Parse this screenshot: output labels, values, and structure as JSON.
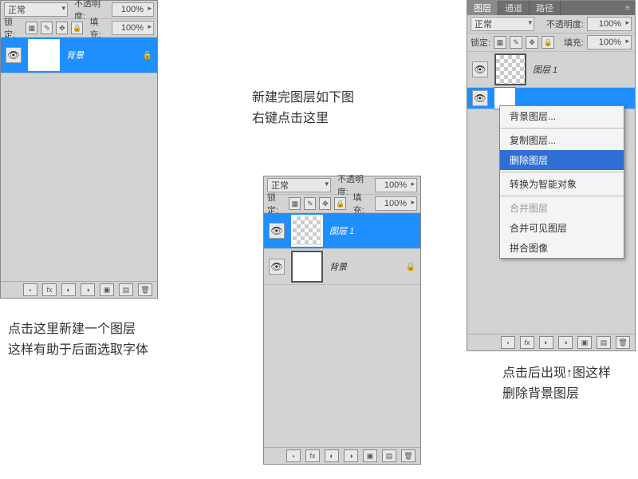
{
  "shared": {
    "blend_label": "正常",
    "opacity_label": "不透明度:",
    "opacity_value": "100%",
    "lock_label": "锁定:",
    "fill_label": "填充:",
    "fill_value": "100%"
  },
  "tabs": {
    "layers": "图层",
    "channels": "通道",
    "paths": "路径"
  },
  "layer_names": {
    "background": "背景",
    "layer1": "图层 1"
  },
  "context_menu": {
    "bg_layer": "背景图层...",
    "dup_layer": "复制图层...",
    "del_layer": "删除图层",
    "smart_obj": "转换为智能对象",
    "merge": "合并图层",
    "merge_visible": "合并可见图层",
    "flatten": "拼合图像"
  },
  "captions": {
    "c1a": "点击这里新建一个图层",
    "c1b": "这样有助于后面选取字体",
    "c2a": "新建完图层如下图",
    "c2b": "右键点击这里",
    "c3a": "点击后出现↑图这样",
    "c3b": "删除背景图层"
  }
}
